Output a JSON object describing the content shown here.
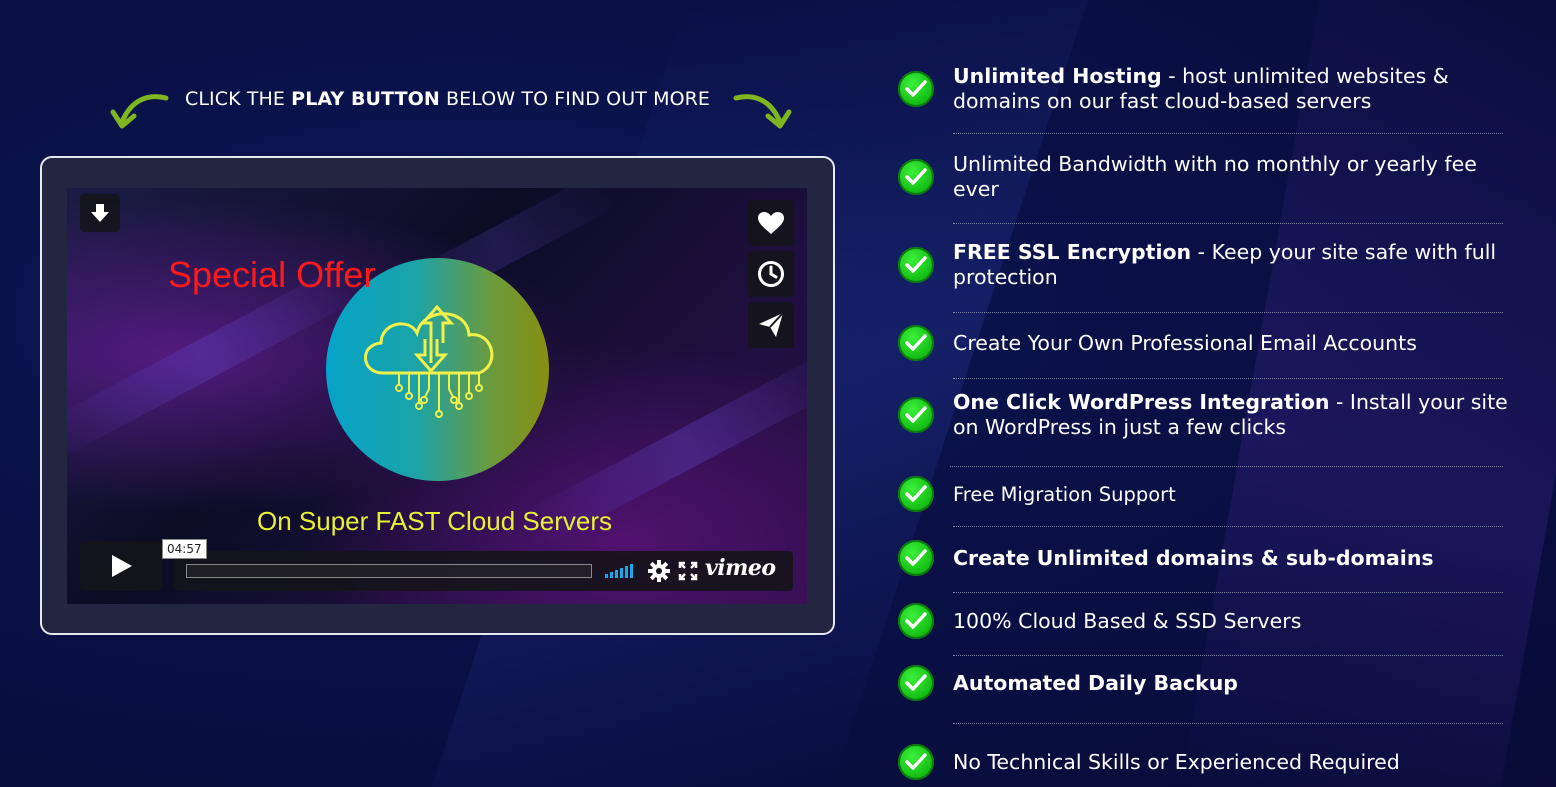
{
  "cta": {
    "prefix": "CLICK THE ",
    "bold": "PLAY BUTTON",
    "suffix": " BELOW TO FIND OUT MORE"
  },
  "video": {
    "overlay_offer": "Special Offer",
    "overlay_subtitle": "On Super FAST Cloud Servers",
    "duration": "04:57",
    "brand": "vimeo",
    "icons": [
      "download-icon",
      "heart-icon",
      "clock-icon",
      "send-icon",
      "play-icon",
      "volume-icon",
      "settings-icon",
      "fullscreen-icon"
    ]
  },
  "features": [
    {
      "bold": "Unlimited Hosting",
      "rest": " - host unlimited websites & domains on our fast cloud-based servers"
    },
    {
      "bold": "",
      "rest": "Unlimited Bandwidth with no monthly or yearly fee ever"
    },
    {
      "bold": "FREE SSL Encryption",
      "rest": " -  Keep your site safe with full protection"
    },
    {
      "bold": "",
      "rest": "Create Your Own Professional Email Accounts"
    },
    {
      "bold": "One Click WordPress Integration",
      "rest": " - Install your site on WordPress in just a few clicks"
    },
    {
      "bold": "",
      "rest": "Free Migration Support"
    },
    {
      "bold": "Create Unlimited domains & sub-domains",
      "rest": ""
    },
    {
      "bold": "",
      "rest": "100% Cloud Based & SSD Servers"
    },
    {
      "bold": "Automated Daily Backup",
      "rest": ""
    },
    {
      "bold": "",
      "rest": "No Technical Skills or Experienced Required"
    }
  ],
  "colors": {
    "background": "#0a1148",
    "check_green": "#17c217",
    "offer_red": "#ff1a1a",
    "subtitle_yellow": "#e8f033",
    "arrow_green": "#7fb51e"
  }
}
